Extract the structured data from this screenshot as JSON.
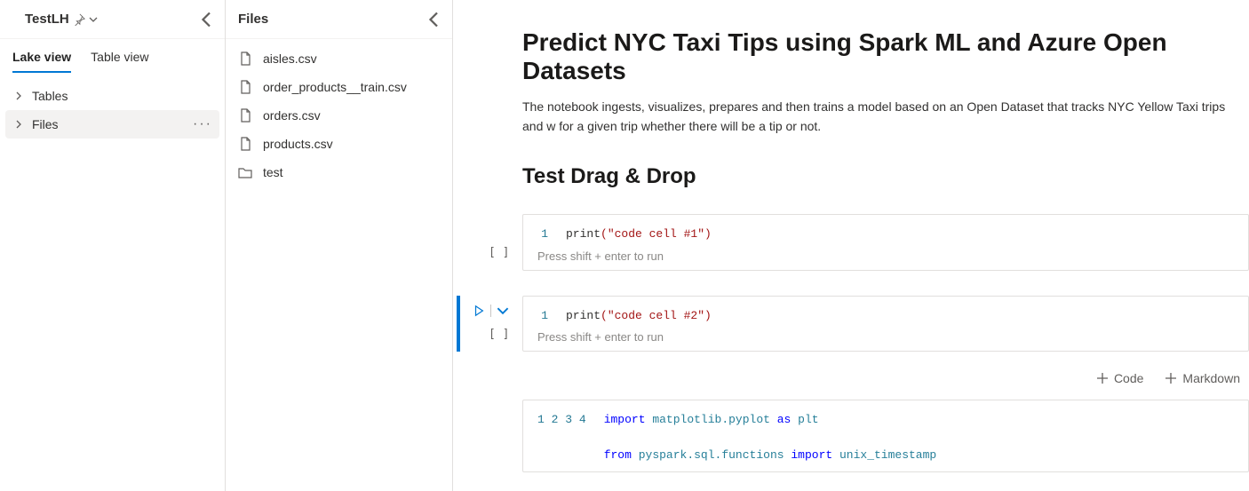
{
  "workspace": {
    "name": "TestLH"
  },
  "left_tabs": {
    "lake": "Lake view",
    "table": "Table view",
    "active": "lake"
  },
  "tree": {
    "tables_label": "Tables",
    "files_label": "Files"
  },
  "files_panel": {
    "title": "Files",
    "items": [
      {
        "name": "aisles.csv",
        "kind": "file"
      },
      {
        "name": "order_products__train.csv",
        "kind": "file"
      },
      {
        "name": "orders.csv",
        "kind": "file"
      },
      {
        "name": "products.csv",
        "kind": "file"
      },
      {
        "name": "test",
        "kind": "folder"
      }
    ]
  },
  "notebook": {
    "title": "Predict NYC Taxi Tips using Spark ML and Azure Open Datasets",
    "description": "The notebook ingests, visualizes, prepares and then trains a model based on an Open Dataset that tracks NYC Yellow Taxi trips and w for a given trip whether there will be a tip or not.",
    "section_heading": "Test Drag & Drop",
    "run_hint": "Press shift + enter to run",
    "brackets": "[ ]",
    "cell1": {
      "n": "1",
      "code_fn": "print",
      "code_str": "(\"code cell #1\")"
    },
    "cell2": {
      "n": "1",
      "code_fn": "print",
      "code_str": "(\"code cell #2\")"
    },
    "cell3": {
      "lines": [
        "1",
        "2",
        "3",
        "4"
      ],
      "l1_kw": "import",
      "l1_mod": "matplotlib.pyplot",
      "l1_as": "as",
      "l1_alias": "plt",
      "l3_from": "from",
      "l3_mod": "pyspark.sql.functions",
      "l3_imp": "import",
      "l3_name": "unix_timestamp"
    },
    "add": {
      "code": "Code",
      "markdown": "Markdown"
    }
  }
}
